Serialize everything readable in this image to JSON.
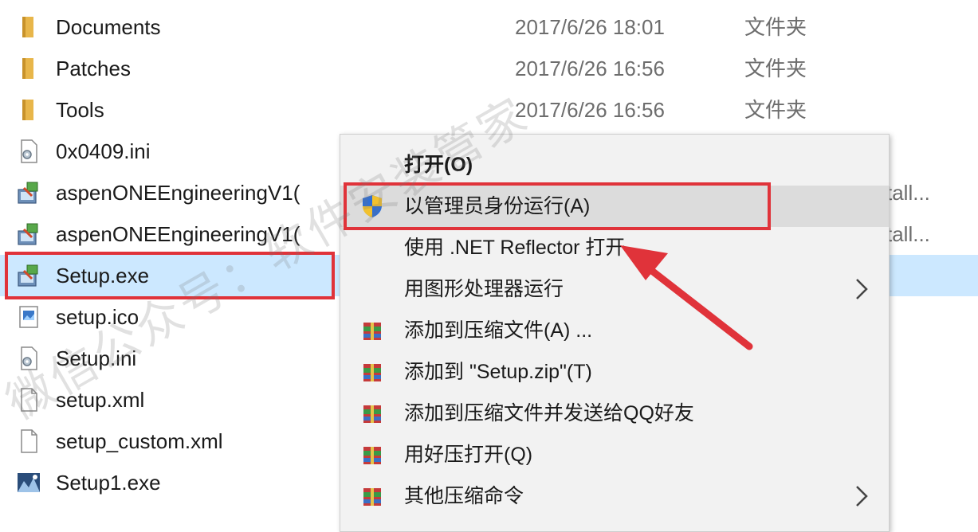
{
  "files": [
    {
      "name": "Documents",
      "date": "2017/6/26 18:01",
      "type": "文件夹",
      "icon": "folder-icon"
    },
    {
      "name": "Patches",
      "date": "2017/6/26 16:56",
      "type": "文件夹",
      "icon": "folder-icon"
    },
    {
      "name": "Tools",
      "date": "2017/6/26 16:56",
      "type": "文件夹",
      "icon": "folder-icon"
    },
    {
      "name": "0x0409.ini",
      "date": "",
      "type": "",
      "icon": "settings-file-icon"
    },
    {
      "name": "aspenONEEngineeringV1(",
      "date": "",
      "type": "",
      "tail": "tall...",
      "icon": "installer-icon"
    },
    {
      "name": "aspenONEEngineeringV1(",
      "date": "",
      "type": "",
      "tail": "tall...",
      "icon": "installer-icon"
    },
    {
      "name": "Setup.exe",
      "date": "",
      "type": "",
      "icon": "installer-icon"
    },
    {
      "name": "setup.ico",
      "date": "",
      "type": "",
      "icon": "image-file-icon"
    },
    {
      "name": "Setup.ini",
      "date": "",
      "type": "",
      "icon": "settings-file-icon"
    },
    {
      "name": "setup.xml",
      "date": "",
      "type": "",
      "icon": "blank-file-icon"
    },
    {
      "name": "setup_custom.xml",
      "date": "",
      "type": "",
      "icon": "blank-file-icon"
    },
    {
      "name": "Setup1.exe",
      "date": "",
      "type": "",
      "icon": "app-icon"
    }
  ],
  "context_menu": {
    "items": [
      {
        "label": "打开(O)",
        "icon": "",
        "bold": true
      },
      {
        "label": "以管理员身份运行(A)",
        "icon": "uac-shield-icon"
      },
      {
        "label": "使用 .NET Reflector 打开",
        "icon": ""
      },
      {
        "label": "用图形处理器运行",
        "icon": "",
        "submenu": true
      },
      {
        "label": "添加到压缩文件(A) ...",
        "icon": "archive-icon"
      },
      {
        "label": "添加到 \"Setup.zip\"(T)",
        "icon": "archive-icon"
      },
      {
        "label": "添加到压缩文件并发送给QQ好友",
        "icon": "archive-icon"
      },
      {
        "label": "用好压打开(Q)",
        "icon": "archive-icon"
      },
      {
        "label": "其他压缩命令",
        "icon": "archive-icon",
        "submenu": true
      }
    ]
  },
  "watermark": "微信公众号：软件安装管家",
  "colors": {
    "selection": "#cce8ff",
    "highlight": "#e0333a",
    "menu_background": "#f2f2f2",
    "menu_hover": "#dcdcdc"
  }
}
